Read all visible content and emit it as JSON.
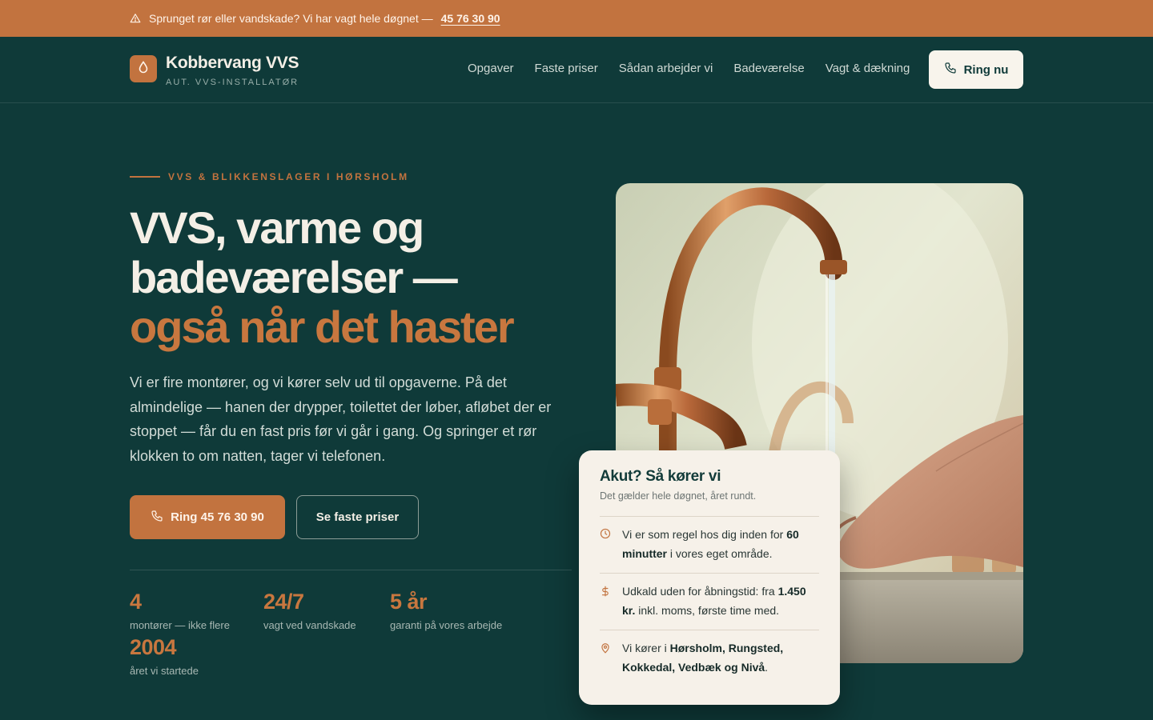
{
  "alert": {
    "text": "Sprunget rør eller vandskade? Vi har vagt hele døgnet —",
    "phone": "45 76 30 90",
    "icon": "warning-triangle-icon"
  },
  "header": {
    "brand_name": "Kobbervang VVS",
    "brand_sub": "AUT. VVS-INSTALLATØR",
    "logo_icon": "water-drop-icon",
    "nav": [
      "Opgaver",
      "Faste priser",
      "Sådan arbejder vi",
      "Badeværelse",
      "Vagt & dækning"
    ],
    "call_label": "Ring nu"
  },
  "hero": {
    "eyebrow": "VVS & BLIKKENSLAGER I HØRSHOLM",
    "title_line1": "VVS, varme og",
    "title_line2": "badeværelser —",
    "title_line3": "også når det haster",
    "body": "Vi er fire montører, og vi kører selv ud til opgaverne. På det almindelige — hanen der drypper, toilettet der løber, afløbet der er stoppet — får du en fast pris før vi går i gang. Og springer et rør klokken to om natten, tager vi telefonen.",
    "cta_primary": "Ring 45 76 30 90",
    "cta_secondary": "Se faste priser"
  },
  "stats": [
    {
      "value": "4",
      "label": "montører — ikke flere"
    },
    {
      "value": "24/7",
      "label": "vagt ved vandskade"
    },
    {
      "value": "5 år",
      "label": "garanti på vores arbejde"
    },
    {
      "value": "2004",
      "label": "året vi startede"
    }
  ],
  "urgent_card": {
    "title": "Akut? Så kører vi",
    "subtitle": "Det gælder hele døgnet, året rundt.",
    "items": [
      {
        "icon": "clock-icon",
        "pre": "Vi er som regel hos dig inden for ",
        "bold": "60 minutter",
        "post": " i vores eget område."
      },
      {
        "icon": "dollar-icon",
        "pre": "Udkald uden for åbningstid: fra ",
        "bold": "1.450 kr.",
        "post": " inkl. moms, første time med."
      },
      {
        "icon": "location-pin-icon",
        "pre": "Vi kører i ",
        "bold": "Hørsholm, Rungsted, Kokkedal, Vedbæk og Nivå",
        "post": "."
      }
    ]
  },
  "colors": {
    "background": "#0f3a39",
    "accent": "#c2733f",
    "card": "#f6f1e9",
    "text_light": "#f4efe6"
  }
}
